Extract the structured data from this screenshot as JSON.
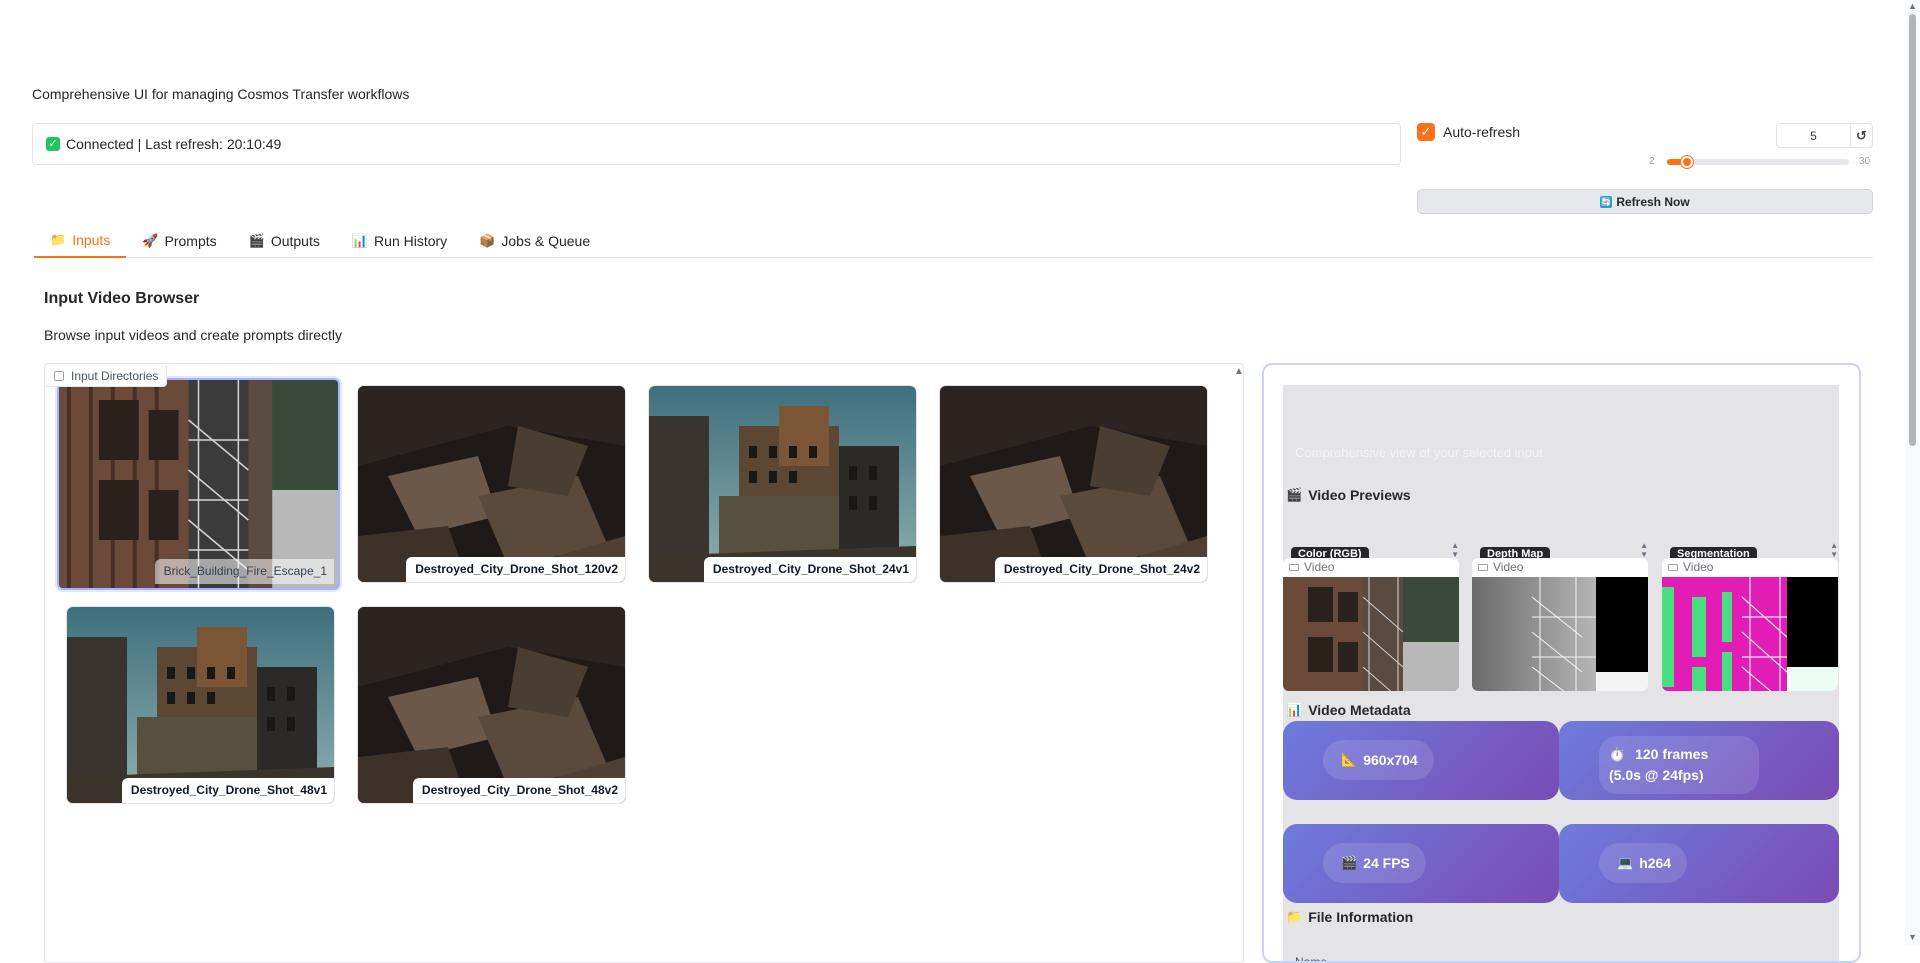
{
  "app": {
    "subtitle": "Comprehensive UI for managing Cosmos Transfer workflows",
    "accent_color": "#f97316"
  },
  "status": {
    "text": "Connected | Last refresh: 20:10:49",
    "icon": "check-icon",
    "color": "#22c55e"
  },
  "auto_refresh": {
    "label": "Auto-refresh",
    "checked": true,
    "interval_value": "5",
    "reset_icon": "↺",
    "slider_min": "2",
    "slider_max": "30",
    "slider_value": 5
  },
  "refresh_button": {
    "label": "Refresh Now",
    "icon": "refresh-icon"
  },
  "tabs": [
    {
      "label": "Inputs",
      "icon": "folder-icon",
      "glyph": "📁",
      "active": true
    },
    {
      "label": "Prompts",
      "icon": "rocket-icon",
      "glyph": "🚀",
      "active": false
    },
    {
      "label": "Outputs",
      "icon": "clapper-icon",
      "glyph": "🎬",
      "active": false
    },
    {
      "label": "Run History",
      "icon": "bar-chart-icon",
      "glyph": "📊",
      "active": false
    },
    {
      "label": "Jobs & Queue",
      "icon": "package-icon",
      "glyph": "📦",
      "active": false
    }
  ],
  "browser": {
    "title": "Input Video Browser",
    "description": "Browse input videos and create prompts directly",
    "gallery_label": "Input Directories",
    "items": [
      {
        "name": "Brick_Building_Fire_Escape_1",
        "selected": true
      },
      {
        "name": "Destroyed_City_Drone_Shot_120v2",
        "selected": false
      },
      {
        "name": "Destroyed_City_Drone_Shot_24v1",
        "selected": false
      },
      {
        "name": "Destroyed_City_Drone_Shot_24v2",
        "selected": false
      },
      {
        "name": "Destroyed_City_Drone_Shot_48v1",
        "selected": false
      },
      {
        "name": "Destroyed_City_Drone_Shot_48v2",
        "selected": false
      }
    ]
  },
  "details": {
    "description": "Comprehensive view of your selected input",
    "previews_heading": "Video Previews",
    "previews_icon": "🎬",
    "previews": [
      {
        "tab_label": "Color (RGB)",
        "badge": "Video"
      },
      {
        "tab_label": "Depth Map",
        "badge": "Video"
      },
      {
        "tab_label": "Segmentation",
        "badge": "Video"
      }
    ],
    "metadata_heading": "Video Metadata",
    "metadata_icon": "📊",
    "metadata": {
      "resolution": "960x704",
      "resolution_icon": "📐",
      "frames": "120 frames (5.0s @ 24fps)",
      "frames_icon": "⏱️",
      "fps": "24 FPS",
      "fps_icon": "🎬",
      "codec": "h264",
      "codec_icon": "💻"
    },
    "file_heading": "File Information",
    "file_icon": "📁",
    "name_label": "Name"
  }
}
